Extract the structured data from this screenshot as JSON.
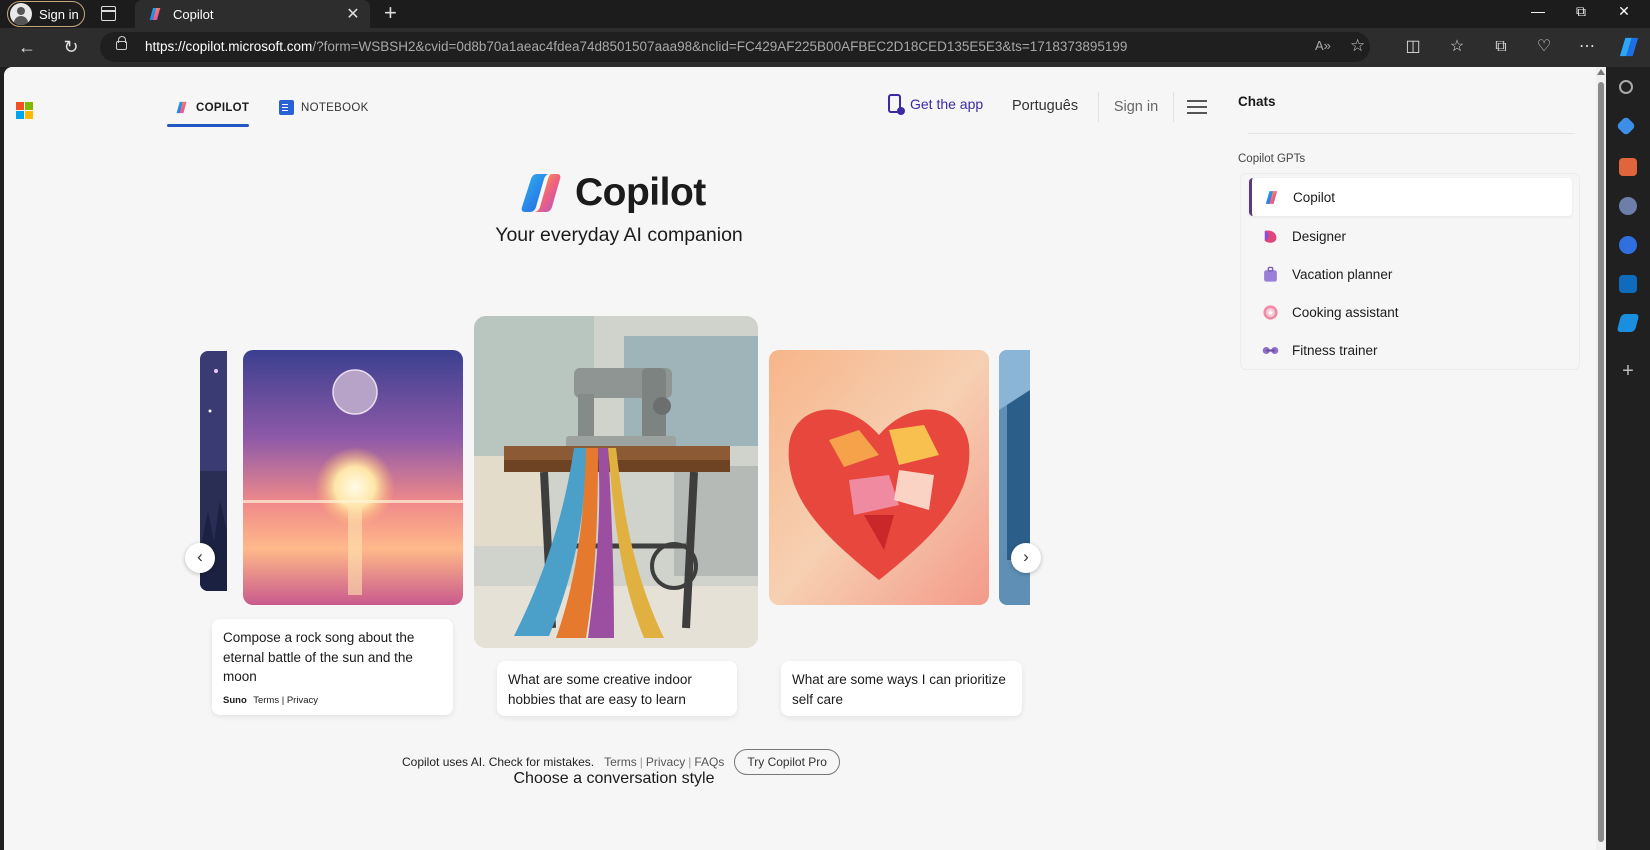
{
  "browser": {
    "profile_label": "Sign in",
    "tab_title": "Copilot",
    "url_domain": "https://copilot.microsoft.com",
    "url_path": "/?form=WSBSH2&cvid=0d8b70a1aeac4fdea74d8501507aaa98&nclid=FC429AF225B00AFBEC2D18CED135E5E3&ts=1718373895199",
    "read_aloud": "A»",
    "win_minimize": "—",
    "win_restore": "⧉",
    "win_close": "✕"
  },
  "topnav": {
    "copilot_tab": "COPILOT",
    "notebook_tab": "NOTEBOOK",
    "get_app": "Get the app",
    "language": "Português",
    "sign_in": "Sign in"
  },
  "hero": {
    "title": "Copilot",
    "subtitle": "Your everyday AI companion"
  },
  "carousel": {
    "cards": [
      {
        "prompt": "Compose a rock song about the eternal battle of the sun and the moon",
        "brand": "Suno",
        "terms": "Terms",
        "privacy": "Privacy"
      },
      {
        "prompt": "What are some creative indoor hobbies that are easy to learn"
      },
      {
        "prompt": "What are some ways I can prioritize self care"
      }
    ]
  },
  "footer": {
    "disclaimer": "Copilot uses AI. Check for mistakes.",
    "terms": "Terms",
    "privacy": "Privacy",
    "faqs": "FAQs",
    "pro_button": "Try Copilot Pro",
    "conversation_style": "Choose a conversation style"
  },
  "side_panel": {
    "chats_title": "Chats",
    "gpts_title": "Copilot GPTs",
    "gpts": [
      {
        "label": "Copilot",
        "icon": "copilot-icon",
        "active": true
      },
      {
        "label": "Designer",
        "icon": "designer-icon"
      },
      {
        "label": "Vacation planner",
        "icon": "suitcase-icon"
      },
      {
        "label": "Cooking assistant",
        "icon": "donut-icon"
      },
      {
        "label": "Fitness trainer",
        "icon": "dumbbell-icon"
      }
    ]
  },
  "colors": {
    "accent_blue": "#2256c4",
    "get_app_purple": "#3b2aa6",
    "active_gpt_marker": "#5b3a7a"
  }
}
